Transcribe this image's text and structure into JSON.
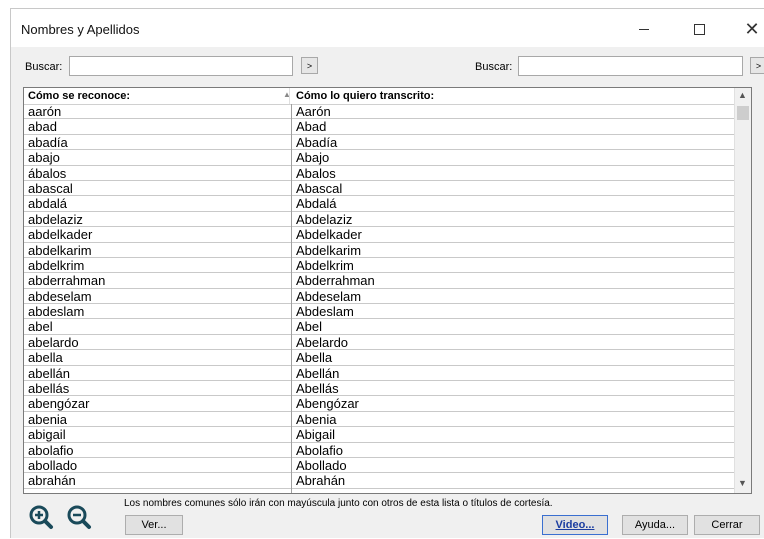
{
  "window": {
    "title": "Nombres y Apellidos",
    "controls": {
      "minimize": "minimize-icon",
      "maximize": "maximize-icon",
      "close": "close-icon"
    }
  },
  "search": {
    "left_label": "Buscar:",
    "left_value": "",
    "right_label": "Buscar:",
    "right_value": "",
    "go_label": ">"
  },
  "table": {
    "headers": [
      "Cómo se reconoce:",
      "Cómo lo quiero transcrito:"
    ],
    "rows": [
      [
        "aarón",
        "Aarón"
      ],
      [
        "abad",
        "Abad"
      ],
      [
        "abadía",
        "Abadía"
      ],
      [
        "abajo",
        "Abajo"
      ],
      [
        "ábalos",
        "Abalos"
      ],
      [
        "abascal",
        "Abascal"
      ],
      [
        "abdalá",
        "Abdalá"
      ],
      [
        "abdelaziz",
        "Abdelaziz"
      ],
      [
        "abdelkader",
        "Abdelkader"
      ],
      [
        "abdelkarim",
        "Abdelkarim"
      ],
      [
        "abdelkrim",
        "Abdelkrim"
      ],
      [
        "abderrahman",
        "Abderrahman"
      ],
      [
        "abdeselam",
        "Abdeselam"
      ],
      [
        "abdeslam",
        "Abdeslam"
      ],
      [
        "abel",
        "Abel"
      ],
      [
        "abelardo",
        "Abelardo"
      ],
      [
        "abella",
        "Abella"
      ],
      [
        "abellán",
        "Abellán"
      ],
      [
        "abellás",
        "Abellás"
      ],
      [
        "abengózar",
        "Abengózar"
      ],
      [
        "abenia",
        "Abenia"
      ],
      [
        "abigail",
        "Abigail"
      ],
      [
        "abolafio",
        "Abolafio"
      ],
      [
        "abollado",
        "Abollado"
      ],
      [
        "abrahán",
        "Abrahán"
      ]
    ]
  },
  "footer": {
    "note": "Los nombres comunes sólo irán con mayúscula junto con otros de esta lista o títulos de cortesía.",
    "ver_label": "Ver...",
    "video_label": "Video...",
    "ayuda_label": "Ayuda...",
    "cerrar_label": "Cerrar",
    "zoom_in_icon": "zoom-in-icon",
    "zoom_out_icon": "zoom-out-icon"
  }
}
